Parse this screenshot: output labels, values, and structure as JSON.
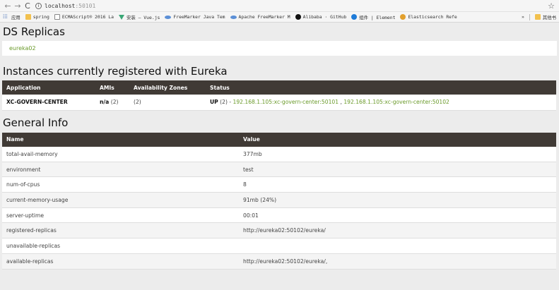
{
  "browser": {
    "url_host": "localhost",
    "url_port": ":50101",
    "bookmarks": [
      {
        "label": "应用",
        "icon": "apps-icon"
      },
      {
        "label": "spring",
        "icon": "folder-icon"
      },
      {
        "label": "ECMAScript® 2016 La",
        "icon": "page-icon"
      },
      {
        "label": "安装 — Vue.js",
        "icon": "vue-icon"
      },
      {
        "label": "FreeMarker Java Tem",
        "icon": "freemarker-icon"
      },
      {
        "label": "Apache FreeMarker M",
        "icon": "freemarker-icon"
      },
      {
        "label": "Alibaba · GitHub",
        "icon": "github-icon"
      },
      {
        "label": "组件 | Element",
        "icon": "element-icon"
      },
      {
        "label": "Elasticsearch Refe",
        "icon": "elasticsearch-icon"
      }
    ],
    "more_label": "»",
    "other_bookmarks": "其他书"
  },
  "ds_replicas": {
    "title": "DS Replicas",
    "replica": "eureka02"
  },
  "instances": {
    "title": "Instances currently registered with Eureka",
    "headers": [
      "Application",
      "AMIs",
      "Availability Zones",
      "Status"
    ],
    "rows": [
      {
        "application": "XC-GOVERN-CENTER",
        "amis_bold": "n/a",
        "amis_count": " (2)",
        "zones": "(2)",
        "status_prefix": "UP",
        "status_count": " (2) - ",
        "link1": "192.168.1.105:xc-govern-center:50101",
        "separator": " , ",
        "link2": "192.168.1.105:xc-govern-center:50102"
      }
    ]
  },
  "general_info": {
    "title": "General Info",
    "headers": [
      "Name",
      "Value"
    ],
    "rows": [
      {
        "name": "total-avail-memory",
        "value": "377mb"
      },
      {
        "name": "environment",
        "value": "test"
      },
      {
        "name": "num-of-cpus",
        "value": "8"
      },
      {
        "name": "current-memory-usage",
        "value": "91mb (24%)"
      },
      {
        "name": "server-uptime",
        "value": "00:01"
      },
      {
        "name": "registered-replicas",
        "value": "http://eureka02:50102/eureka/"
      },
      {
        "name": "unavailable-replicas",
        "value": ""
      },
      {
        "name": "available-replicas",
        "value": "http://eureka02:50102/eureka/,"
      }
    ]
  }
}
